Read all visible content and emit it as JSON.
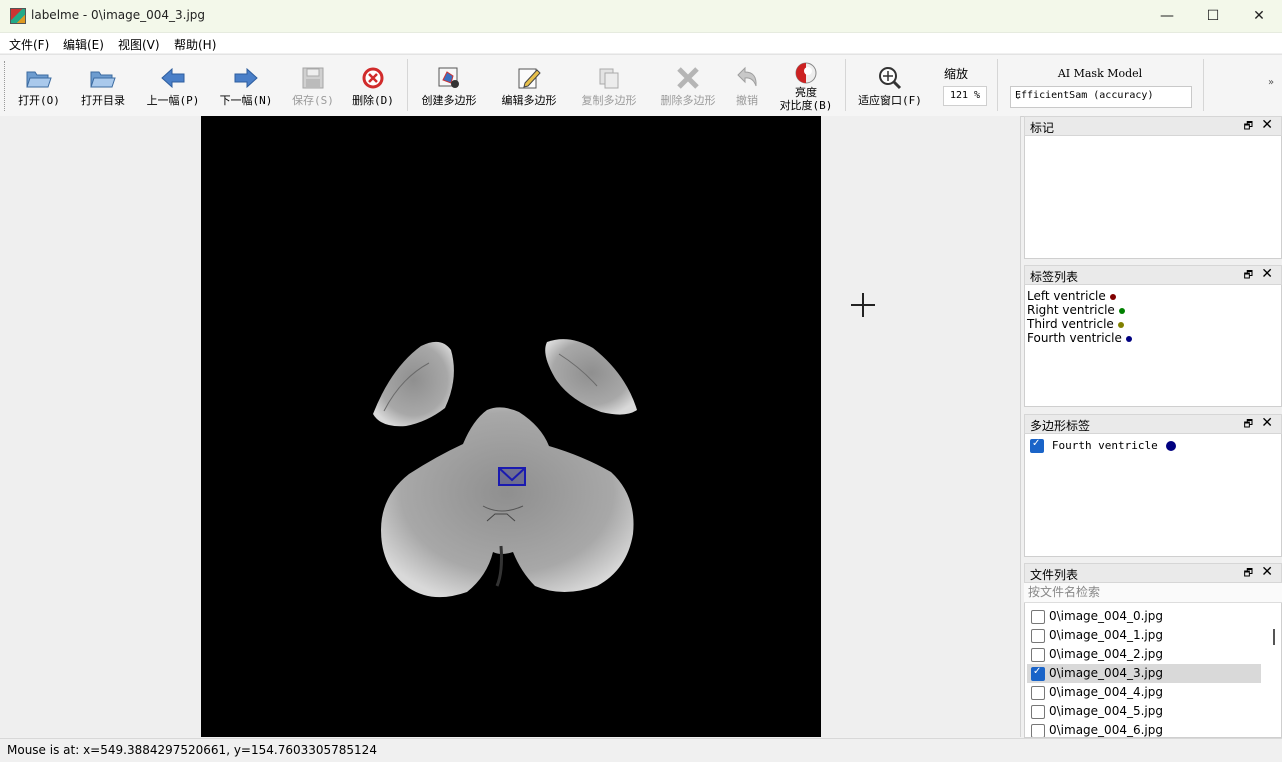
{
  "window": {
    "title": "labelme - 0\\image_004_3.jpg",
    "minimize": "—",
    "maximize": "☐",
    "close": "✕"
  },
  "menu": [
    "文件(F)",
    "编辑(E)",
    "视图(V)",
    "帮助(H)"
  ],
  "toolbar": {
    "open": "打开(O)",
    "open_dir": "打开目录",
    "prev": "上一幅(P)",
    "next": "下一幅(N)",
    "save": "保存(S)",
    "delete": "删除(D)",
    "create_polygon": "创建多边形",
    "edit_polygon": "编辑多边形",
    "copy_polygon": "复制多边形",
    "delete_polygon": "删除多边形",
    "undo": "撤销",
    "brightness_line1": "亮度",
    "brightness_line2": "对比度(B)",
    "fit_window": "适应窗口(F)",
    "zoom_label": "缩放",
    "zoom_value": "121 %",
    "ai_label": "AI Mask Model",
    "ai_model": "EfficientSam (accuracy)",
    "more": "»"
  },
  "docks": {
    "flags": {
      "title": "标记"
    },
    "label_list": {
      "title": "标签列表",
      "items": [
        {
          "name": "Left ventricle",
          "color": "#800000"
        },
        {
          "name": "Right ventricle",
          "color": "#008000"
        },
        {
          "name": "Third ventricle",
          "color": "#808000"
        },
        {
          "name": "Fourth ventricle",
          "color": "#000080"
        }
      ]
    },
    "polygon_labels": {
      "title": "多边形标签",
      "items": [
        {
          "name": "Fourth ventricle",
          "color": "#000080",
          "checked": true
        }
      ]
    },
    "file_list": {
      "title": "文件列表",
      "search_placeholder": "按文件名检索",
      "files": [
        {
          "name": "0\\image_004_0.jpg",
          "checked": false
        },
        {
          "name": "0\\image_004_1.jpg",
          "checked": false
        },
        {
          "name": "0\\image_004_2.jpg",
          "checked": false
        },
        {
          "name": "0\\image_004_3.jpg",
          "checked": true
        },
        {
          "name": "0\\image_004_4.jpg",
          "checked": false
        },
        {
          "name": "0\\image_004_5.jpg",
          "checked": false
        },
        {
          "name": "0\\image_004_6.jpg",
          "checked": false
        }
      ]
    },
    "float_icon": "🗗",
    "close_icon": "✕"
  },
  "status": "Mouse is at: x=549.3884297520661, y=154.7603305785124"
}
